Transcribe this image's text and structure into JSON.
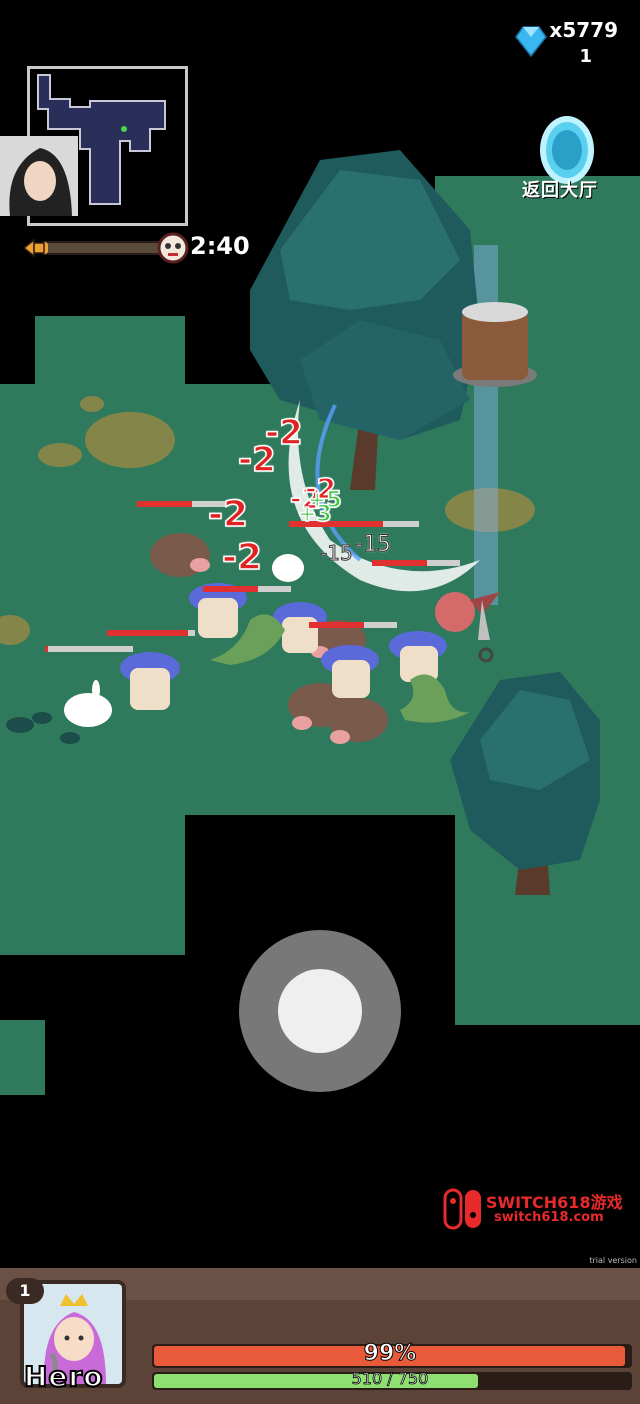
{
  "hud": {
    "gem_count": "x5779",
    "gem_sub": "1",
    "timer": "2:40",
    "portal_label": "返回大厅",
    "gem_color": "#39b7f0",
    "stage_progress_fraction": 0.05
  },
  "damage_numbers": [
    "-2",
    "-2",
    "-2",
    "-2",
    "-2",
    "-2",
    "+5",
    "+3",
    "-15",
    "-15"
  ],
  "watermark": {
    "title": "SWITCH618游戏",
    "url": "switch618.com",
    "trial": "trial version"
  },
  "player": {
    "level": "1",
    "name": "Hero",
    "hp_percent_text": "99%",
    "hp_fraction": 0.99,
    "xp_text": "510 / 750",
    "xp_fraction": 0.68
  },
  "colors": {
    "grass": "#2f7a5c",
    "hp_fill": "#e85a3a",
    "xp_fill": "#8ee070",
    "damage": "#e02222",
    "heal": "#3cc43c",
    "panel": "#5b4338"
  },
  "icons": [
    "gem-icon",
    "portal-icon",
    "skull-boss-icon",
    "joystick",
    "switch-logo-icon"
  ]
}
